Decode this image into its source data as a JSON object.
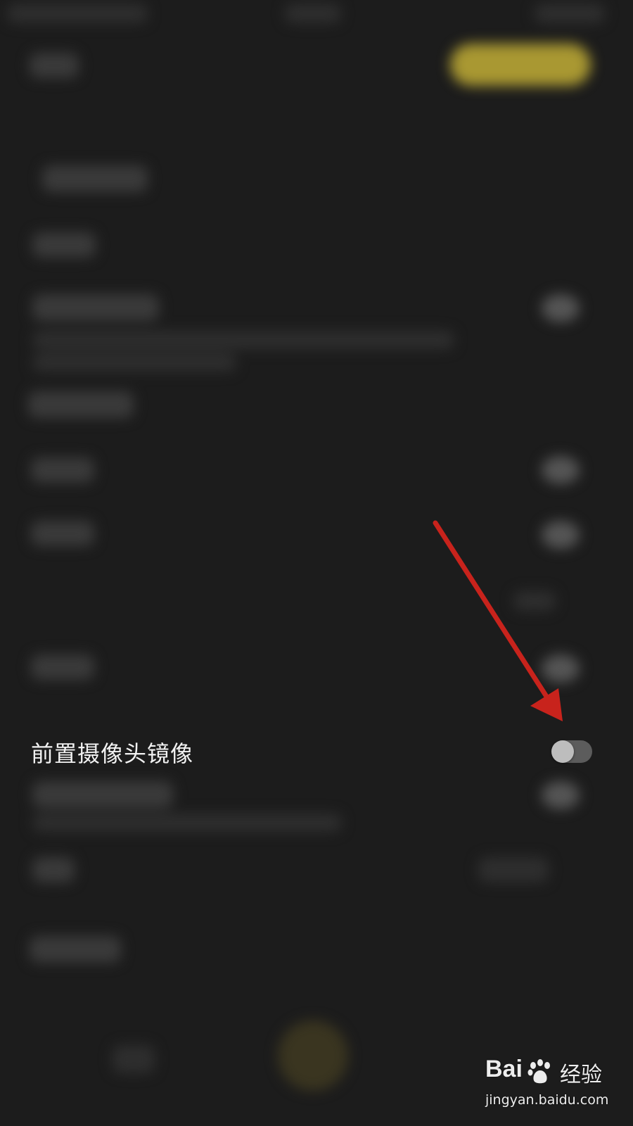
{
  "settings": {
    "front_camera_mirror": {
      "label": "前置摄像头镜像",
      "enabled": false
    }
  },
  "watermark": {
    "logo_text": "Bai",
    "logo_text_2": "经验",
    "url": "jingyan.baidu.com"
  },
  "annotation": {
    "arrow_color": "#c8231c"
  },
  "colors": {
    "background": "#1c1c1c",
    "accent_yellow": "#a99832",
    "toggle_track_off": "#5c5c5c",
    "toggle_knob": "#bdbdbd"
  }
}
